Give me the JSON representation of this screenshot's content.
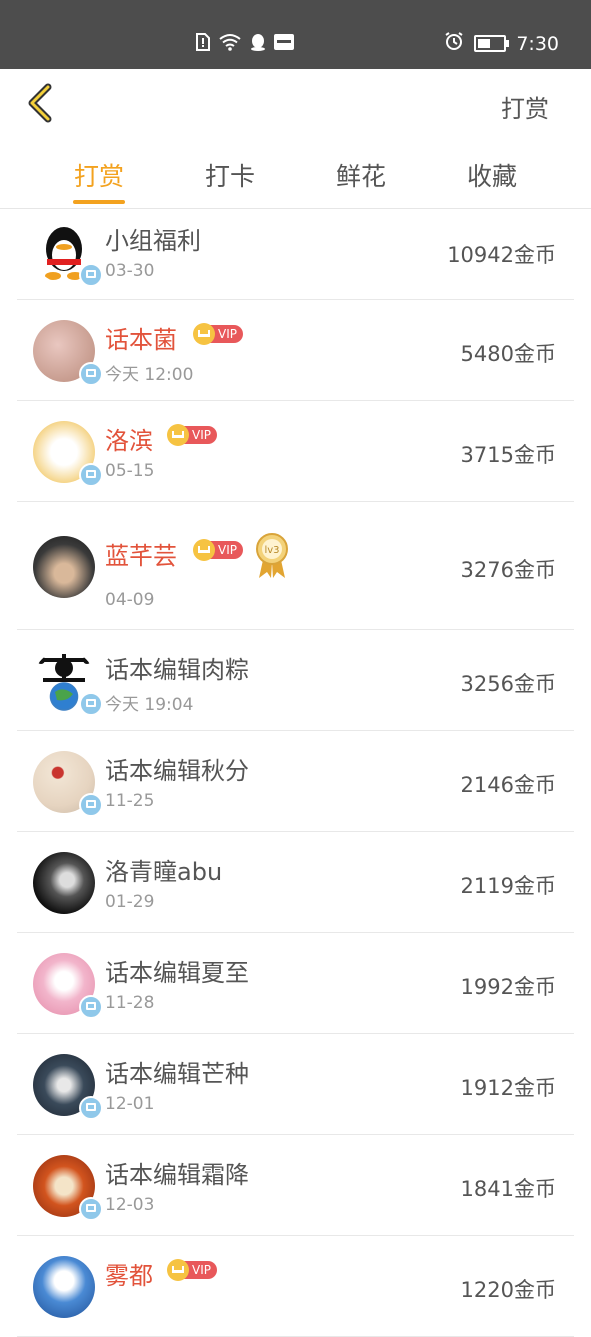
{
  "status_bar": {
    "time": "7:30"
  },
  "header": {
    "back_icon": "chevron-left-icon",
    "right_label": "打赏"
  },
  "tabs": [
    {
      "label": "打赏",
      "active": true
    },
    {
      "label": "打卡",
      "active": false
    },
    {
      "label": "鲜花",
      "active": false
    },
    {
      "label": "收藏",
      "active": false
    }
  ],
  "accent_color": "#f3a21f",
  "vip_label": "VIP",
  "medal_label": "lv3",
  "list": [
    {
      "name": "小组福利",
      "date": "03-30",
      "amount": "10942金币",
      "vip": false
    },
    {
      "name": "话本菌",
      "date": "今天 12:00",
      "amount": "5480金币",
      "vip": true
    },
    {
      "name": "洛滨",
      "date": "05-15",
      "amount": "3715金币",
      "vip": true
    },
    {
      "name": "蓝芊芸",
      "date": "04-09",
      "amount": "3276金币",
      "vip": true,
      "medal": "lv3"
    },
    {
      "name": "话本编辑肉粽",
      "date": "今天 19:04",
      "amount": "3256金币",
      "vip": false
    },
    {
      "name": "话本编辑秋分",
      "date": "11-25",
      "amount": "2146金币",
      "vip": false
    },
    {
      "name": "洛青瞳abu",
      "date": "01-29",
      "amount": "2119金币",
      "vip": false
    },
    {
      "name": "话本编辑夏至",
      "date": "11-28",
      "amount": "1992金币",
      "vip": false
    },
    {
      "name": "话本编辑芒种",
      "date": "12-01",
      "amount": "1912金币",
      "vip": false
    },
    {
      "name": "话本编辑霜降",
      "date": "12-03",
      "amount": "1841金币",
      "vip": false
    },
    {
      "name": "雾都",
      "date": "",
      "amount": "1220金币",
      "vip": true
    }
  ]
}
